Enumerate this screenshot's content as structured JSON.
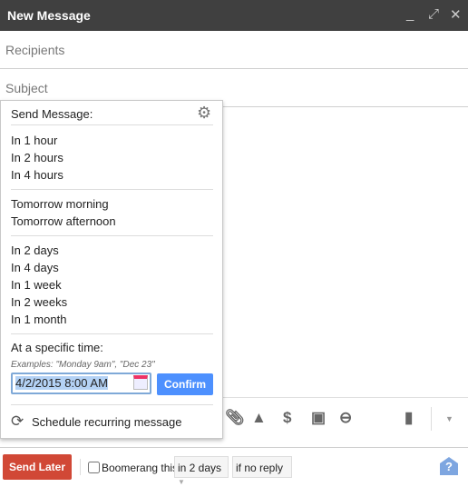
{
  "window": {
    "title": "New Message",
    "minimize": "_",
    "expand": "⤢",
    "close": "✕"
  },
  "fields": {
    "recipients": "Recipients",
    "subject": "Subject"
  },
  "popup": {
    "title": "Send Message:",
    "groups": [
      [
        "In 1 hour",
        "In 2 hours",
        "In 4 hours"
      ],
      [
        "Tomorrow morning",
        "Tomorrow afternoon"
      ],
      [
        "In 2 days",
        "In 4 days",
        "In 1 week",
        "In 2 weeks",
        "In 1 month"
      ]
    ],
    "specific_label": "At a specific time:",
    "examples": "Examples: \"Monday 9am\", \"Dec 23\"",
    "datetime_value": "4/2/2015 8:00 AM",
    "confirm": "Confirm",
    "recurring": "Schedule recurring message"
  },
  "toolbar": {
    "icons": [
      "paperclip-icon",
      "drive-icon",
      "dollar-icon",
      "image-icon",
      "link-icon",
      "trash-icon",
      "more-options-icon"
    ]
  },
  "bottom": {
    "send_later": "Send Later",
    "boomerang_label": "Boomerang this",
    "boomerang_checked": false,
    "delay": "in 2 days",
    "condition": "if no reply",
    "help": "?"
  },
  "colors": {
    "header": "#404040",
    "send_later": "#d14836",
    "confirm": "#4d90fe"
  }
}
